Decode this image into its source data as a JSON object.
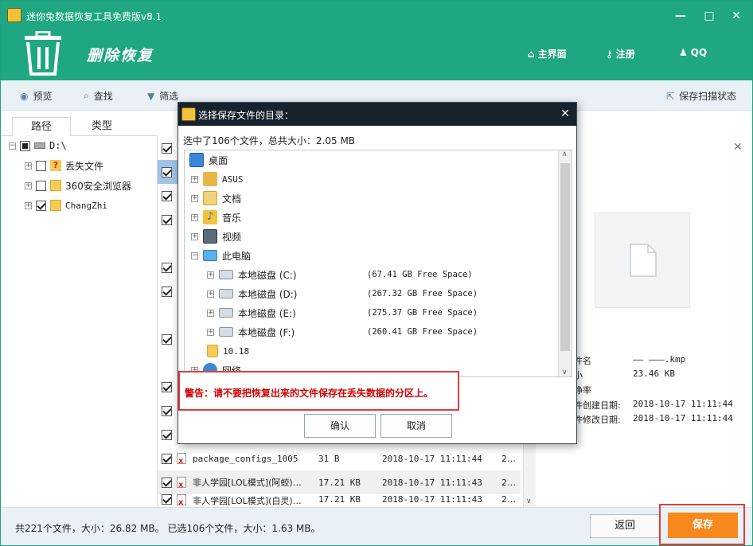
{
  "app": {
    "title": "迷你兔数据恢复工具免费版v8.1",
    "heading": "删除恢复",
    "nav": {
      "home": "主界面",
      "register": "注册",
      "qq": "QQ"
    },
    "window_controls": {
      "minimize": "—",
      "maximize": "□",
      "close": "✕"
    }
  },
  "toolbar": {
    "preview": "预览",
    "find": "查找",
    "filter": "筛选",
    "save_scan": "保存扫描状态"
  },
  "tabs": {
    "path": "路径",
    "type": "类型"
  },
  "tree": {
    "root": "D:\\",
    "items": [
      {
        "label": "丢失文件",
        "checked": false
      },
      {
        "label": "360安全浏览器",
        "checked": false
      },
      {
        "label": "ChangZhi",
        "checked": true
      }
    ]
  },
  "files": [
    {
      "name": "package_configs_1005",
      "size": "31 B",
      "date": "2018-10-17 11:11:44",
      "extra": "2…"
    },
    {
      "name": "非人学园[LOL模式](阿蛟)…",
      "size": "17.21 KB",
      "date": "2018-10-17 11:11:43",
      "extra": "2…"
    },
    {
      "name": "非人学园[LOL模式](白灵)…",
      "size": "17.21 KB",
      "date": "2018-10-17 11:11:43",
      "extra": "2…"
    }
  ],
  "preview": {
    "labels": {
      "name": "件名",
      "size": "小",
      "ratio": "诤率",
      "created": "件创建日期:",
      "modified": "件修改日期:"
    },
    "values": {
      "name": "—— ———.kmp",
      "size": "23.46 KB",
      "created": "2018-10-17 11:11:44",
      "modified": "2018-10-17 11:11:44"
    }
  },
  "status": {
    "text": "共221个文件，大小：26.82 MB。 已选106个文件，大小：1.63 MB。",
    "back": "返回",
    "save": "保存"
  },
  "dialog": {
    "title": "选择保存文件的目录：",
    "summary": "选中了106个文件，总共大小：2.05 MB",
    "items": [
      {
        "label": "桌面",
        "space": ""
      },
      {
        "label": "ASUS",
        "space": ""
      },
      {
        "label": "文档",
        "space": ""
      },
      {
        "label": "音乐",
        "space": ""
      },
      {
        "label": "视频",
        "space": ""
      },
      {
        "label": "此电脑",
        "space": ""
      },
      {
        "label": "本地磁盘 (C:)",
        "space": "(67.41 GB Free Space)"
      },
      {
        "label": "本地磁盘 (D:)",
        "space": "(267.32 GB Free Space)"
      },
      {
        "label": "本地磁盘 (E:)",
        "space": "(275.37 GB Free Space)"
      },
      {
        "label": "本地磁盘 (F:)",
        "space": "(260.41 GB Free Space)"
      },
      {
        "label": "10.18",
        "space": ""
      },
      {
        "label": "网络",
        "space": ""
      }
    ],
    "warning": "警告：请不要把恢复出来的文件保存在丢失数据的分区上。",
    "ok": "确认",
    "cancel": "取消"
  },
  "colors": {
    "brand": "#1fa781",
    "accent": "#f7891d",
    "warning": "#e53a3a"
  }
}
